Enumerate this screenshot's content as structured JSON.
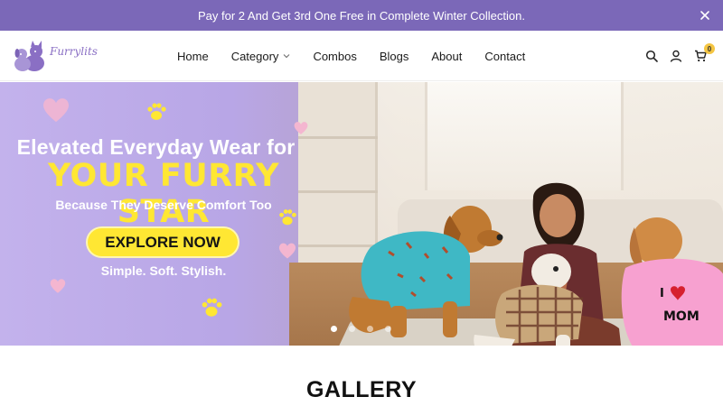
{
  "announcement": {
    "text": "Pay for 2 And Get 3rd One Free in Complete Winter Collection.",
    "close_icon": "close-icon"
  },
  "header": {
    "logo_text": "Furrylits",
    "nav": [
      {
        "label": "Home"
      },
      {
        "label": "Category",
        "has_dropdown": true
      },
      {
        "label": "Combos"
      },
      {
        "label": "Blogs"
      },
      {
        "label": "About"
      },
      {
        "label": "Contact"
      }
    ],
    "icons": [
      "search-icon",
      "account-icon",
      "cart-icon"
    ],
    "cart_count": "0"
  },
  "hero": {
    "line1": "Elevated Everyday Wear for",
    "line2": "YOUR FURRY STAR",
    "line3": "Because They Deserve Comfort Too",
    "cta": "EXPLORE NOW",
    "line4": "Simple. Soft. Stylish.",
    "shirt_text": "I ♥ MOM",
    "slides": 4,
    "active_slide": 1
  },
  "gallery": {
    "title": "GALLERY"
  },
  "colors": {
    "announce_bg": "#7b68b8",
    "accent_yellow": "#ffe733",
    "brand_purple": "#8a6fc4"
  }
}
